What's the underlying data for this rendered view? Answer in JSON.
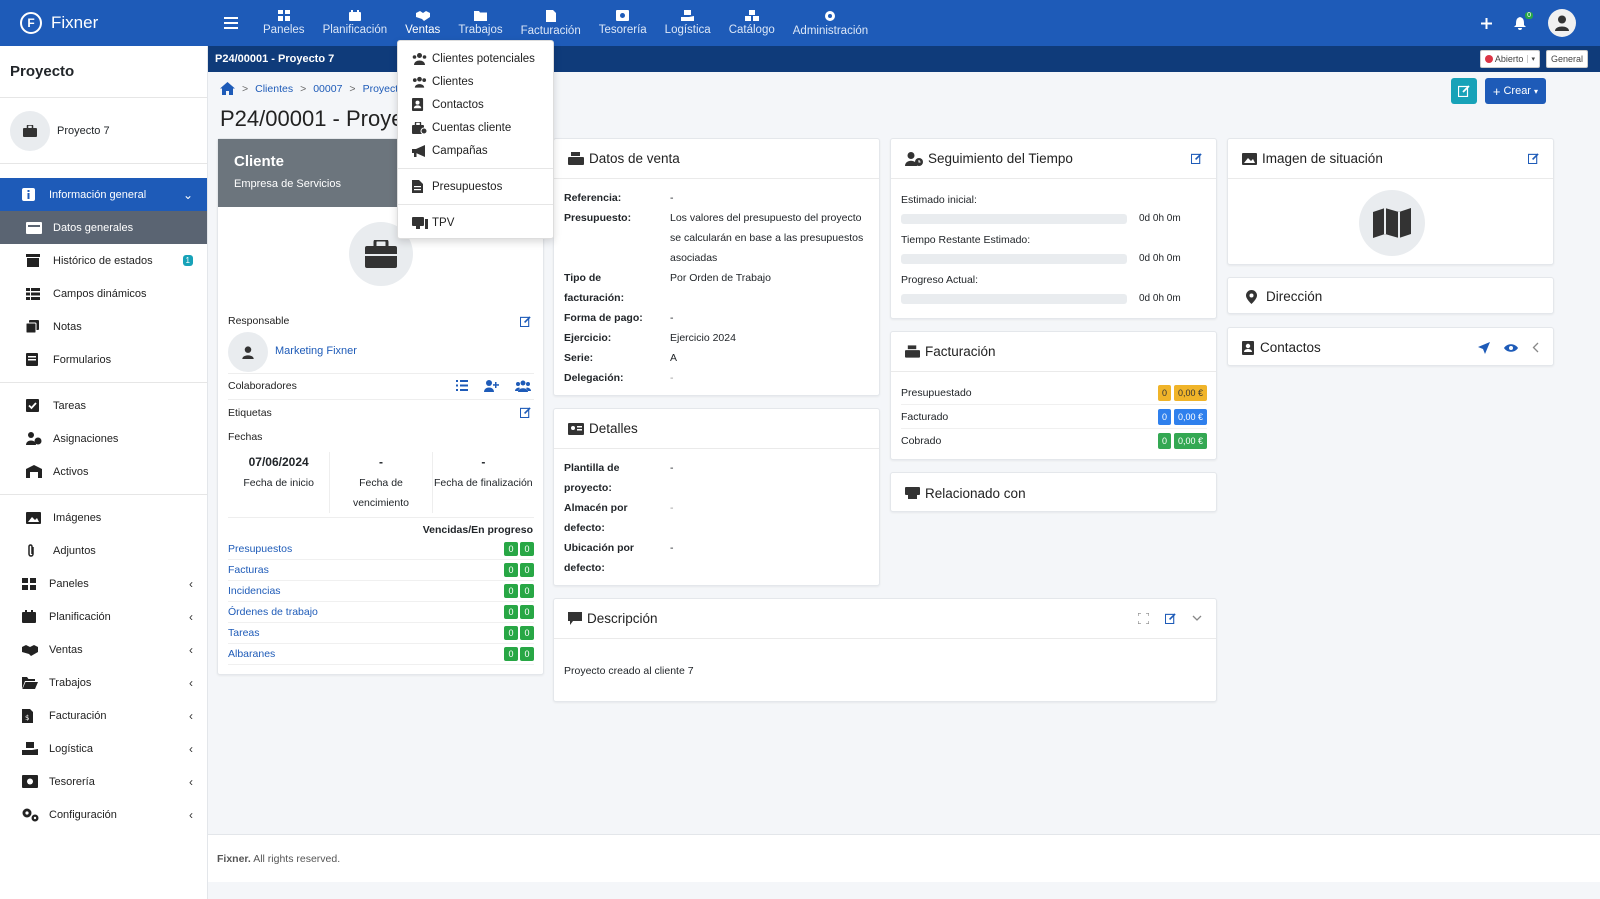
{
  "brand": {
    "name": "Fixner",
    "logo_letter": "F"
  },
  "topnav": [
    {
      "label": "Paneles",
      "icon": "grid-icon"
    },
    {
      "label": "Planificación",
      "icon": "calendar-icon"
    },
    {
      "label": "Ventas",
      "icon": "handshake-icon",
      "active": true
    },
    {
      "label": "Trabajos",
      "icon": "folder-icon"
    },
    {
      "label": "Facturación",
      "icon": "invoice-icon"
    },
    {
      "label": "Tesorería",
      "icon": "money-icon"
    },
    {
      "label": "Logística",
      "icon": "hand-box-icon"
    },
    {
      "label": "Catálogo",
      "icon": "catalog-icon"
    },
    {
      "label": "Administración",
      "icon": "gear-icon"
    }
  ],
  "notifications": {
    "count": "0"
  },
  "titlebar": {
    "title": "P24/00001 - Proyecto 7",
    "status": "Abierto",
    "scope": "General"
  },
  "sidebar": {
    "title": "Proyecto",
    "project_name": "Proyecto 7",
    "general": "Información general",
    "datos": "Datos generales",
    "historico": "Histórico de estados",
    "historico_badge": "1",
    "campos": "Campos dinámicos",
    "notas": "Notas",
    "formularios": "Formularios",
    "tareas": "Tareas",
    "asignaciones": "Asignaciones",
    "activos": "Activos",
    "imagenes": "Imágenes",
    "adjuntos": "Adjuntos",
    "paneles": "Paneles",
    "planificacion": "Planificación",
    "ventas": "Ventas",
    "trabajos": "Trabajos",
    "facturacion": "Facturación",
    "logistica": "Logística",
    "tesoreria": "Tesorería",
    "configuracion": "Configuración"
  },
  "breadcrumb": {
    "sep": ">",
    "c1": "Clientes",
    "c2": "00007",
    "c3": "Proyecto"
  },
  "page_title": "P24/00001 - Proyecto 7",
  "actions": {
    "crear": "Crear"
  },
  "cliente": {
    "title": "Cliente",
    "subtitle": "Empresa de Servicios",
    "responsable_label": "Responsable",
    "responsable": "Marketing Fixner",
    "colaboradores_label": "Colaboradores",
    "etiquetas_label": "Etiquetas",
    "fechas_label": "Fechas",
    "fecha_inicio_value": "07/06/2024",
    "fecha_inicio_label": "Fecha de inicio",
    "fecha_venc_value": "-",
    "fecha_venc_label": "Fecha de vencimiento",
    "fecha_fin_value": "-",
    "fecha_fin_label": "Fecha de finalización",
    "vencidas_label": "Vencidas/En progreso",
    "links": [
      {
        "label": "Presupuestos",
        "a": "0",
        "b": "0"
      },
      {
        "label": "Facturas",
        "a": "0",
        "b": "0"
      },
      {
        "label": "Incidencias",
        "a": "0",
        "b": "0"
      },
      {
        "label": "Órdenes de trabajo",
        "a": "0",
        "b": "0"
      },
      {
        "label": "Tareas",
        "a": "0",
        "b": "0"
      },
      {
        "label": "Albaranes",
        "a": "0",
        "b": "0"
      }
    ]
  },
  "venta": {
    "title": "Datos de venta",
    "referencia_l": "Referencia:",
    "referencia_v": "-",
    "presupuesto_l": "Presupuesto:",
    "presupuesto_v": "Los valores del presupuesto del proyecto se calcularán en base a las presupuestos asociadas",
    "tipo_l": "Tipo de facturación:",
    "tipo_v": "Por Orden de Trabajo",
    "forma_l": "Forma de pago:",
    "forma_v": "-",
    "ejercicio_l": "Ejercicio:",
    "ejercicio_v": "Ejercicio 2024",
    "serie_l": "Serie:",
    "serie_v": "A",
    "delegacion_l": "Delegación:",
    "delegacion_v": "-"
  },
  "detalles": {
    "title": "Detalles",
    "plantilla_l": "Plantilla de proyecto:",
    "plantilla_v": "-",
    "almacen_l": "Almacén por defecto:",
    "almacen_v": "-",
    "ubicacion_l": "Ubicación por defecto:",
    "ubicacion_v": "-"
  },
  "descripcion": {
    "title": "Descripción",
    "text": "Proyecto creado al cliente 7"
  },
  "tiempo": {
    "title": "Seguimiento del Tiempo",
    "estimado_l": "Estimado inicial:",
    "estimado_v": "0d 0h 0m",
    "estimado_p": 0,
    "restante_l": "Tiempo Restante Estimado:",
    "restante_v": "0d 0h 0m",
    "restante_p": 0,
    "progreso_l": "Progreso Actual:",
    "progreso_v": "0d 0h 0m",
    "progreso_p": 0
  },
  "facturacion": {
    "title": "Facturación",
    "rows": [
      {
        "label": "Presupuestado",
        "count": "0",
        "amount": "0,00 €",
        "color": "#f0b429"
      },
      {
        "label": "Facturado",
        "count": "0",
        "amount": "0,00 €",
        "color": "#2f80ed"
      },
      {
        "label": "Cobrado",
        "count": "0",
        "amount": "0,00 €",
        "color": "#34a853"
      }
    ]
  },
  "relacionado": {
    "title": "Relacionado con"
  },
  "imagen": {
    "title": "Imagen de situación"
  },
  "direccion": {
    "title": "Dirección"
  },
  "contactos": {
    "title": "Contactos"
  },
  "dropdown": {
    "clientes_potenciales": "Clientes potenciales",
    "clientes": "Clientes",
    "contactos": "Contactos",
    "cuentas": "Cuentas cliente",
    "campanas": "Campañas",
    "presupuestos": "Presupuestos",
    "tpv": "TPV"
  },
  "footer": {
    "brand": "Fixner.",
    "text": "All rights reserved."
  }
}
